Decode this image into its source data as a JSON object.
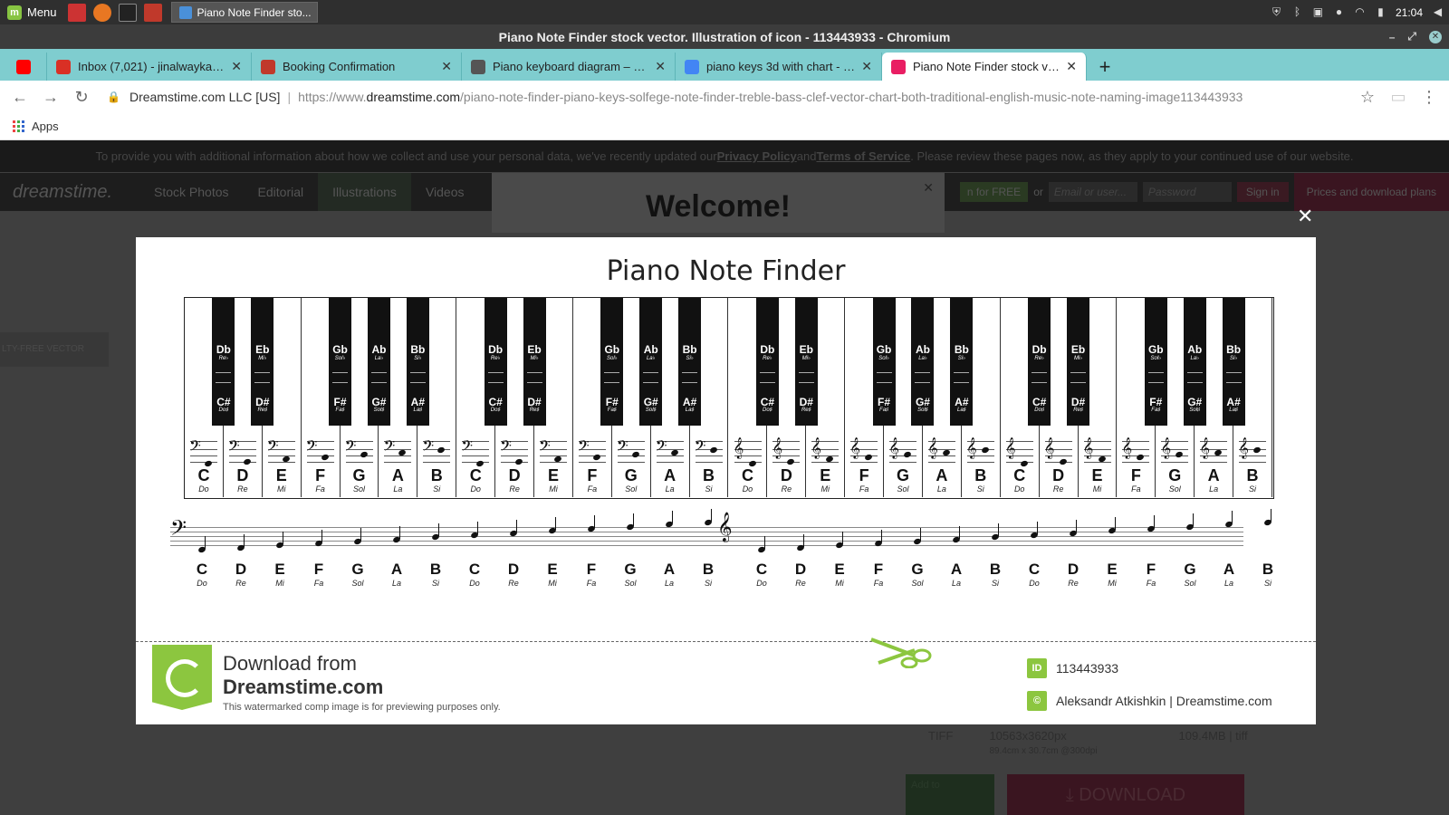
{
  "taskbar": {
    "menu_label": "Menu",
    "task_label": "Piano Note Finder sto...",
    "clock": "21:04"
  },
  "window": {
    "title": "Piano Note Finder stock vector. Illustration of icon - 113443933 - Chromium"
  },
  "tabs": [
    {
      "label": "",
      "icon": "youtube-icon",
      "color": "#ff0000"
    },
    {
      "label": "Inbox (7,021) - jinalwaykar1@gm",
      "icon": "gmail-icon",
      "color": "#d93025"
    },
    {
      "label": "Booking Confirmation",
      "icon": "booking-icon",
      "color": "#c0392b"
    },
    {
      "label": "Piano keyboard diagram – piano",
      "icon": "piano-icon",
      "color": "#555555"
    },
    {
      "label": "piano keys 3d with chart - Goog",
      "icon": "google-icon",
      "color": "#4285f4"
    },
    {
      "label": "Piano Note Finder stock vector.",
      "icon": "dreamstime-icon",
      "color": "#e91e63"
    }
  ],
  "address": {
    "site_identity": "Dreamstime.com LLC [US]",
    "url_scheme": "https://www.",
    "url_host": "dreamstime.com",
    "url_path": "/piano-note-finder-piano-keys-solfege-note-finder-treble-bass-clef-vector-chart-both-traditional-english-music-note-naming-image113443933"
  },
  "bookmarks": {
    "apps_label": "Apps"
  },
  "page": {
    "notice_pre": "To provide you with additional information about how we collect and use your personal data, we've recently updated our ",
    "notice_privacy": "Privacy Policy",
    "notice_and": " and ",
    "notice_terms": "Terms of Service",
    "notice_post": ". Please review these pages now, as they apply to your continued use of our website.",
    "logo": "dreamstime.",
    "nav": [
      "Stock Photos",
      "Editorial",
      "Illustrations",
      "Videos"
    ],
    "join_label": "n for FREE",
    "or_label": "or",
    "email_placeholder": "Email or user...",
    "password_placeholder": "Password",
    "signin_label": "Sign in",
    "plans_label": "Prices and download plans",
    "welcome_title": "Welcome!",
    "side_label": "LTY-FREE VECTOR",
    "tiff_label": "TIFF",
    "tiff_size": "10563x3620px",
    "tiff_sub": "89.4cm x 30.7cm @300dpi",
    "tiff_file": "109.4MB | tiff",
    "add_label": "Add to",
    "download_label": "DOWNLOAD"
  },
  "lightbox": {
    "title": "Piano Note Finder",
    "white_keys": [
      {
        "note": "C",
        "sol": "Do",
        "clef": "bass"
      },
      {
        "note": "D",
        "sol": "Re",
        "clef": "bass"
      },
      {
        "note": "E",
        "sol": "Mi",
        "clef": "bass"
      },
      {
        "note": "F",
        "sol": "Fa",
        "clef": "bass"
      },
      {
        "note": "G",
        "sol": "Sol",
        "clef": "bass"
      },
      {
        "note": "A",
        "sol": "La",
        "clef": "bass"
      },
      {
        "note": "B",
        "sol": "Si",
        "clef": "bass"
      },
      {
        "note": "C",
        "sol": "Do",
        "clef": "bass"
      },
      {
        "note": "D",
        "sol": "Re",
        "clef": "bass"
      },
      {
        "note": "E",
        "sol": "Mi",
        "clef": "bass"
      },
      {
        "note": "F",
        "sol": "Fa",
        "clef": "bass"
      },
      {
        "note": "G",
        "sol": "Sol",
        "clef": "bass"
      },
      {
        "note": "A",
        "sol": "La",
        "clef": "bass"
      },
      {
        "note": "B",
        "sol": "Si",
        "clef": "bass"
      },
      {
        "note": "C",
        "sol": "Do",
        "clef": "treble"
      },
      {
        "note": "D",
        "sol": "Re",
        "clef": "treble"
      },
      {
        "note": "E",
        "sol": "Mi",
        "clef": "treble"
      },
      {
        "note": "F",
        "sol": "Fa",
        "clef": "treble"
      },
      {
        "note": "G",
        "sol": "Sol",
        "clef": "treble"
      },
      {
        "note": "A",
        "sol": "La",
        "clef": "treble"
      },
      {
        "note": "B",
        "sol": "Si",
        "clef": "treble"
      },
      {
        "note": "C",
        "sol": "Do",
        "clef": "treble"
      },
      {
        "note": "D",
        "sol": "Re",
        "clef": "treble"
      },
      {
        "note": "E",
        "sol": "Mi",
        "clef": "treble"
      },
      {
        "note": "F",
        "sol": "Fa",
        "clef": "treble"
      },
      {
        "note": "G",
        "sol": "Sol",
        "clef": "treble"
      },
      {
        "note": "A",
        "sol": "La",
        "clef": "treble"
      },
      {
        "note": "B",
        "sol": "Si",
        "clef": "treble"
      }
    ],
    "black_key_octave": [
      {
        "after": 0,
        "flat": "Db",
        "flat_sol": "Re♭",
        "sharp": "C#",
        "sharp_sol": "Do♯"
      },
      {
        "after": 1,
        "flat": "Eb",
        "flat_sol": "Mi♭",
        "sharp": "D#",
        "sharp_sol": "Re♯"
      },
      {
        "after": 3,
        "flat": "Gb",
        "flat_sol": "Sol♭",
        "sharp": "F#",
        "sharp_sol": "Fa♯"
      },
      {
        "after": 4,
        "flat": "Ab",
        "flat_sol": "La♭",
        "sharp": "G#",
        "sharp_sol": "Sol♯"
      },
      {
        "after": 5,
        "flat": "Bb",
        "flat_sol": "Si♭",
        "sharp": "A#",
        "sharp_sol": "La♯"
      }
    ],
    "octaves": 4,
    "download_from": "Download from",
    "download_site": "Dreamstime.com",
    "preview_note": "This watermarked comp image is for previewing purposes only.",
    "id_badge": "ID",
    "image_id": "113443933",
    "copyright_badge": "©",
    "author": "Aleksandr Atkishkin | Dreamstime.com",
    "accent": "#8cc63f"
  }
}
